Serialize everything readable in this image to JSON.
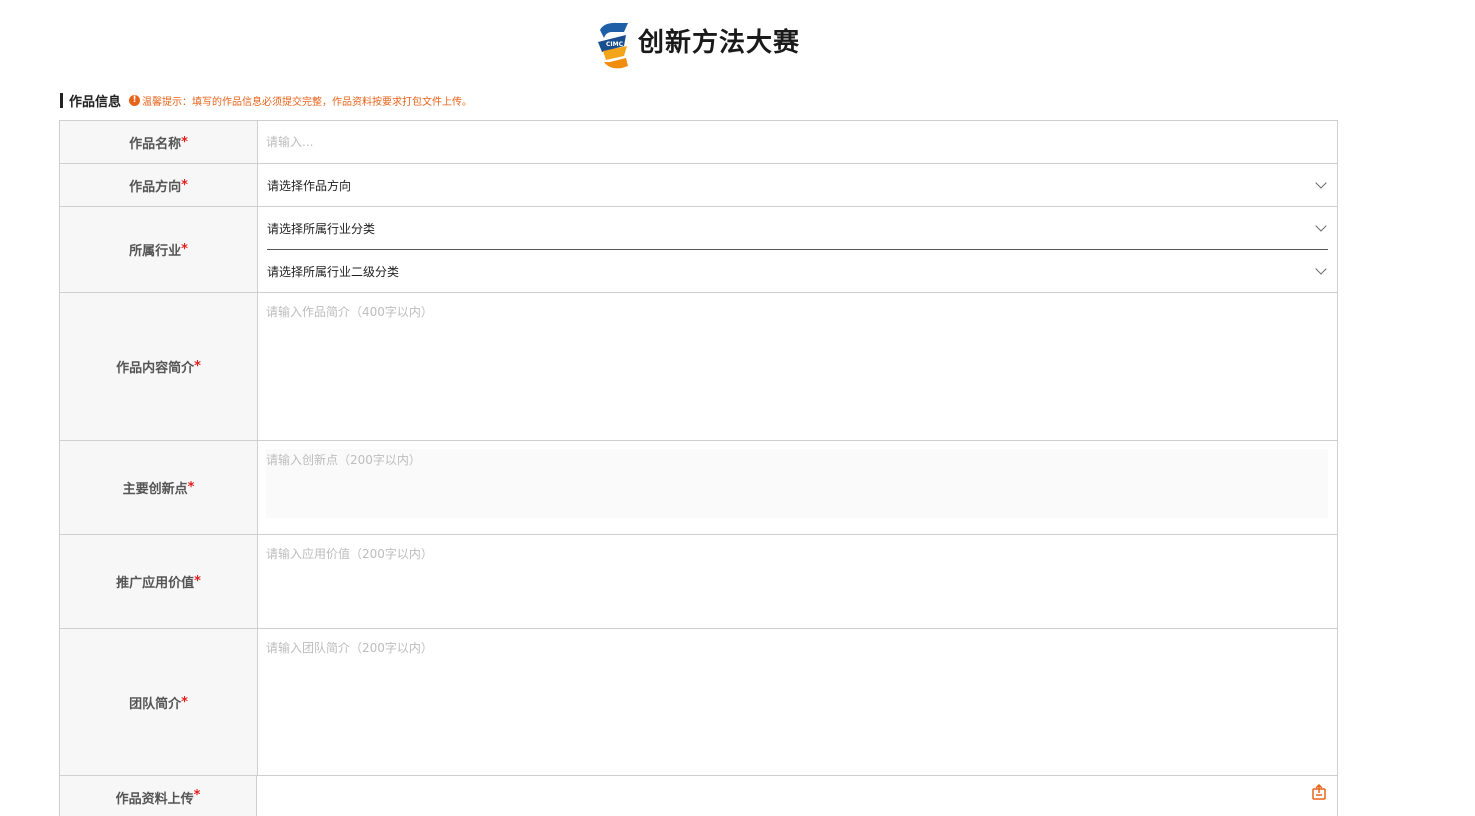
{
  "site": {
    "title": "创新方法大赛",
    "logo_text": "CIMC"
  },
  "section": {
    "title": "作品信息",
    "tip": "温馨提示：填写的作品信息必须提交完整，作品资料按要求打包文件上传。"
  },
  "form": {
    "name": {
      "label": "作品名称",
      "required_mark": "*",
      "placeholder": "请输入..."
    },
    "direction": {
      "label": "作品方向",
      "required_mark": "*",
      "value": "请选择作品方向"
    },
    "industry": {
      "label": "所属行业",
      "required_mark": "*",
      "primary": "请选择所属行业分类",
      "secondary": "请选择所属行业二级分类"
    },
    "summary": {
      "label": "作品内容简介",
      "required_mark": "*",
      "placeholder": "请输入作品简介（400字以内）"
    },
    "innovation": {
      "label": "主要创新点",
      "required_mark": "*",
      "placeholder": "请输入创新点（200字以内）"
    },
    "value": {
      "label": "推广应用价值",
      "required_mark": "*",
      "placeholder": "请输入应用价值（200字以内）"
    },
    "team": {
      "label": "团队简介",
      "required_mark": "*",
      "placeholder": "请输入团队简介（200字以内）"
    },
    "upload": {
      "label": "作品资料上传",
      "required_mark": "*"
    }
  },
  "colors": {
    "accent": "#e8631a",
    "required": "#e02020",
    "label_bg": "#f7f7f7",
    "border": "#cfcfcf"
  },
  "icons": {
    "logo": "cimc-logo-icon",
    "tip": "info-icon",
    "select": "chevron-down-icon",
    "upload": "upload-icon"
  }
}
